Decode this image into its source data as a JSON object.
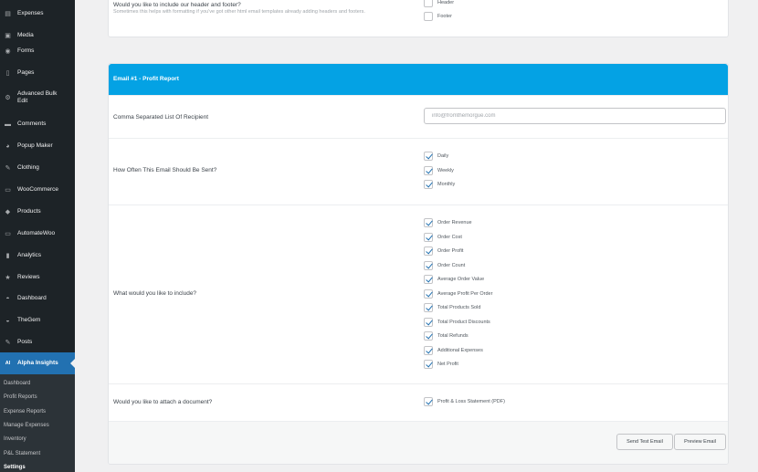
{
  "sidebar": {
    "items": [
      {
        "label": "Expenses",
        "icon": "expenses-icon",
        "glyph": "▤"
      },
      {
        "label": "Media",
        "icon": "media-icon",
        "glyph": "▣"
      },
      {
        "label": "Forms",
        "icon": "forms-icon",
        "glyph": "◉"
      },
      {
        "label": "Pages",
        "icon": "pages-icon",
        "glyph": "▯"
      },
      {
        "label": "Advanced Bulk Edit",
        "icon": "bulk-edit-icon",
        "glyph": "⚙"
      },
      {
        "label": "Comments",
        "icon": "comments-icon",
        "glyph": "▬"
      },
      {
        "label": "Popup Maker",
        "icon": "popup-maker-icon",
        "glyph": "◕"
      },
      {
        "label": "Clothing",
        "icon": "clothing-pin-icon",
        "glyph": "✎"
      },
      {
        "label": "WooCommerce",
        "icon": "woocommerce-icon",
        "glyph": "▭"
      },
      {
        "label": "Products",
        "icon": "products-icon",
        "glyph": "◆"
      },
      {
        "label": "AutomateWoo",
        "icon": "automatewoo-icon",
        "glyph": "▭"
      },
      {
        "label": "Analytics",
        "icon": "analytics-icon",
        "glyph": "▮"
      },
      {
        "label": "Reviews",
        "icon": "reviews-icon",
        "glyph": "★"
      },
      {
        "label": "Dashboard",
        "icon": "dashboard-icon",
        "glyph": "◓"
      },
      {
        "label": "TheGem",
        "icon": "thegem-icon",
        "glyph": "◒"
      },
      {
        "label": "Posts",
        "icon": "posts-pin-icon",
        "glyph": "✎"
      },
      {
        "label": "Alpha Insights",
        "icon": "alpha-insights-icon",
        "glyph": "AI"
      }
    ],
    "submenu": [
      "Dashboard",
      "Profit Reports",
      "Expense Reports",
      "Manage Expenses",
      "Inventory",
      "P&L Statement",
      "Settings"
    ]
  },
  "top_panel": {
    "question": "Would you like to include our header and footer?",
    "description": "Sometimes this helps with formatting if you've got other html email templates already adding headers and footers.",
    "options": [
      {
        "label": "Header",
        "checked": false
      },
      {
        "label": "Footer",
        "checked": false
      }
    ]
  },
  "email_panel": {
    "title": "Email #1 - Profit Report",
    "recipient": {
      "label": "Comma Separated List Of Recipient",
      "placeholder": "info@fromthemorgue.com"
    },
    "frequency": {
      "label": "How Often This Email Should Be Sent?",
      "options": [
        {
          "label": "Daily",
          "checked": true
        },
        {
          "label": "Weekly",
          "checked": true
        },
        {
          "label": "Monthly",
          "checked": true
        }
      ]
    },
    "include": {
      "label": "What would you like to include?",
      "options": [
        {
          "label": "Order Revenue",
          "checked": true
        },
        {
          "label": "Order Cost",
          "checked": true
        },
        {
          "label": "Order Profit",
          "checked": true
        },
        {
          "label": "Order Count",
          "checked": true
        },
        {
          "label": "Average Order Value",
          "checked": true
        },
        {
          "label": "Average Profit Per Order",
          "checked": true
        },
        {
          "label": "Total Products Sold",
          "checked": true
        },
        {
          "label": "Total Product Discounts",
          "checked": true
        },
        {
          "label": "Total Refunds",
          "checked": true
        },
        {
          "label": "Additional Expenses",
          "checked": true
        },
        {
          "label": "Net Profit",
          "checked": true
        }
      ]
    },
    "attach": {
      "label": "Would you like to attach a document?",
      "options": [
        {
          "label": "Profit & Loss Statement (PDF)",
          "checked": true
        }
      ]
    },
    "buttons": {
      "send_test": "Send Test Email",
      "preview": "Preview Email"
    }
  },
  "colors": {
    "sidebar_bg": "#1d2327",
    "active_menu": "#2271b1",
    "panel_header": "#04a2e4"
  }
}
